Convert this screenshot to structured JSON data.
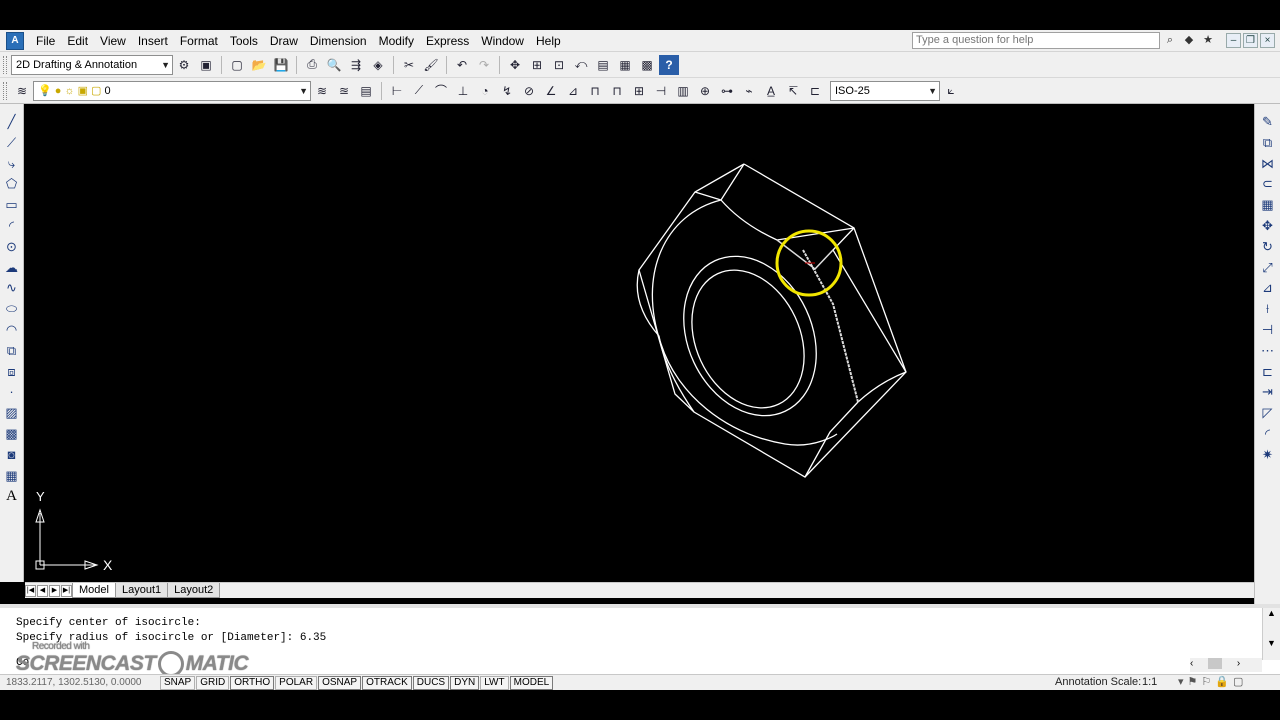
{
  "menubar": {
    "items": [
      "File",
      "Edit",
      "View",
      "Insert",
      "Format",
      "Tools",
      "Draw",
      "Dimension",
      "Modify",
      "Express",
      "Window",
      "Help"
    ],
    "help_placeholder": "Type a question for help"
  },
  "toolbar1": {
    "workspace": "2D Drafting & Annotation"
  },
  "toolbar2": {
    "layer": "0",
    "dimstyle": "ISO-25"
  },
  "canvas": {
    "ucs_y": "Y",
    "ucs_x": "X"
  },
  "layout_tabs": [
    "Model",
    "Layout1",
    "Layout2"
  ],
  "command": {
    "lines": [
      "Specify center of isocircle:",
      "Specify radius of isocircle or [Diameter]: 6.35"
    ],
    "prompt": "Co"
  },
  "watermark": {
    "recorded": "Recorded with",
    "brand_left": "SCREENCAST",
    "brand_right": "MATIC"
  },
  "status": {
    "coords": "1833.2117, 1302.5130, 0.0000",
    "buttons": [
      "SNAP",
      "GRID",
      "ORTHO",
      "POLAR",
      "OSNAP",
      "OTRACK",
      "DUCS",
      "DYN",
      "LWT",
      "MODEL"
    ],
    "annotation_scale_label": "Annotation Scale:",
    "annotation_scale_value": "1:1"
  },
  "colors": {
    "canvas_bg": "#000000",
    "geometry": "#ffffff",
    "cursor_highlight": "#f2e600"
  },
  "icons": {
    "left": [
      "line-icon",
      "construction-line-icon",
      "polyline-icon",
      "polygon-icon",
      "rectangle-icon",
      "arc-icon",
      "circle-icon",
      "revision-cloud-icon",
      "spline-icon",
      "ellipse-icon",
      "ellipse-arc-icon",
      "insert-block-icon",
      "make-block-icon",
      "point-icon",
      "hatch-icon",
      "gradient-icon",
      "region-icon",
      "table-icon",
      "multiline-text-icon"
    ],
    "right": [
      "erase-icon",
      "copy-icon",
      "mirror-icon",
      "offset-icon",
      "array-icon",
      "move-icon",
      "rotate-icon",
      "scale-icon",
      "stretch-icon",
      "trim-icon",
      "extend-icon",
      "break-at-point-icon",
      "break-icon",
      "join-icon",
      "chamfer-icon",
      "fillet-icon",
      "explode-icon"
    ]
  }
}
